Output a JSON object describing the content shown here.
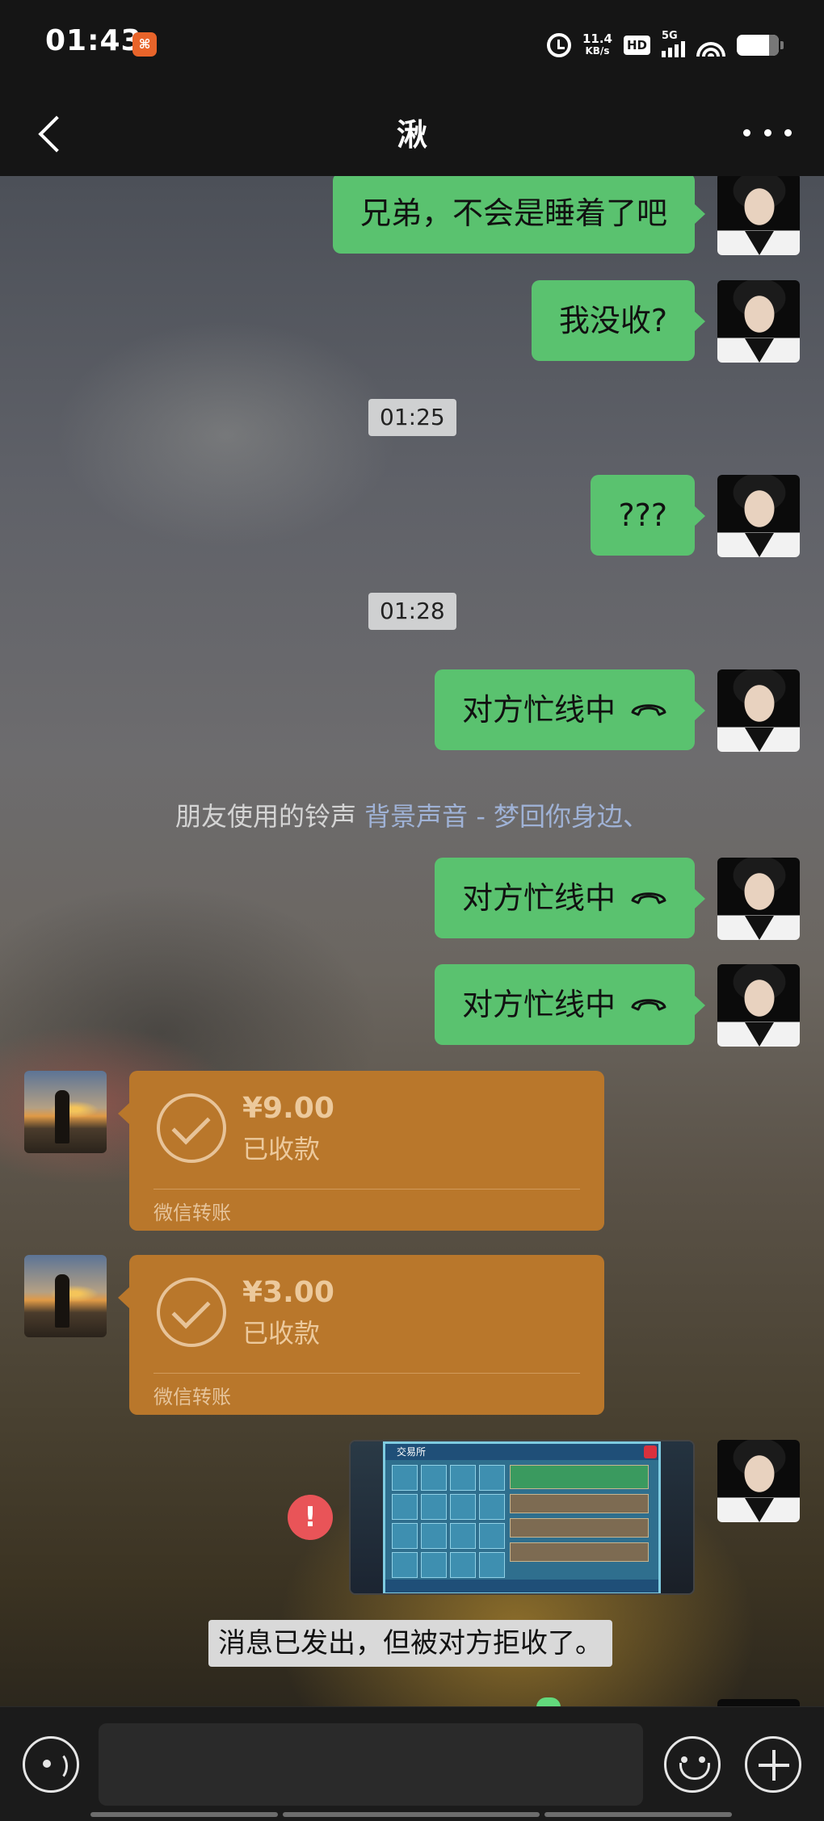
{
  "status_bar": {
    "time": "01:43",
    "network_speed_value": "11.4",
    "network_speed_unit": "KB/s",
    "hd_label": "HD",
    "network_type": "5G",
    "app_icon": "app-notification-icon",
    "icons": [
      "alarm-icon",
      "hd-icon",
      "signal-icon",
      "wifi-icon",
      "battery-icon"
    ]
  },
  "header": {
    "title": "湫",
    "back_icon": "back-chevron-icon",
    "more_icon": "more-dots-icon"
  },
  "messages": [
    {
      "type": "text",
      "sender": "me",
      "text": "兄弟，不会是睡着了吧"
    },
    {
      "type": "text",
      "sender": "me",
      "text": "我没收?"
    },
    {
      "type": "timestamp",
      "text": "01:25"
    },
    {
      "type": "text",
      "sender": "me",
      "text": "???"
    },
    {
      "type": "timestamp",
      "text": "01:28"
    },
    {
      "type": "call",
      "sender": "me",
      "text": "对方忙线中",
      "icon": "hang-up-icon"
    },
    {
      "type": "system",
      "text": "朋友使用的铃声 ",
      "link": "背景声音 - 梦回你身边、"
    },
    {
      "type": "call",
      "sender": "me",
      "text": "对方忙线中",
      "icon": "hang-up-icon"
    },
    {
      "type": "call",
      "sender": "me",
      "text": "对方忙线中",
      "icon": "hang-up-icon"
    },
    {
      "type": "transfer",
      "sender": "friend",
      "amount": "¥9.00",
      "status": "已收款",
      "footer": "微信转账"
    },
    {
      "type": "transfer",
      "sender": "friend",
      "amount": "¥3.00",
      "status": "已收款",
      "footer": "微信转账"
    },
    {
      "type": "image",
      "sender": "me",
      "caption": "交易所",
      "failed": true,
      "error_mark": "!"
    },
    {
      "type": "system_boxed",
      "text": "消息已发出，但被对方拒收了。"
    }
  ],
  "input_bar": {
    "placeholder": "",
    "voice_icon": "voice-icon",
    "emoji_icon": "emoji-icon",
    "plus_icon": "plus-icon"
  },
  "colors": {
    "my_bubble": "#5ac26f",
    "transfer_card": "#b9772b",
    "header_bg": "#151515",
    "error": "#e95458"
  }
}
